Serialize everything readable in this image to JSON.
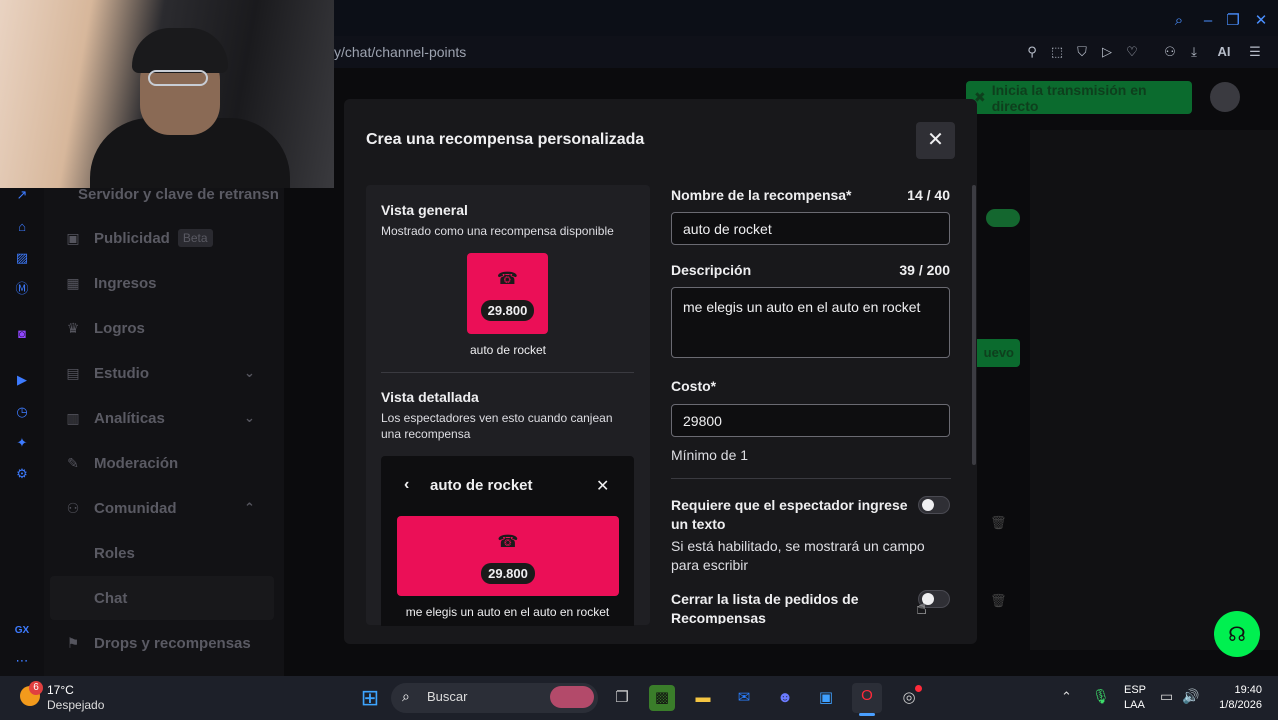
{
  "browser": {
    "url": "y/chat/channel-points",
    "ai_label": "AI"
  },
  "header": {
    "go_live_label": "Inicia la transmisión en directo"
  },
  "sidebar": {
    "items": [
      {
        "label": "Servidor y clave de retransn",
        "icon": "key-icon"
      },
      {
        "label": "Publicidad",
        "badge": "Beta",
        "icon": "ad-icon"
      },
      {
        "label": "Ingresos",
        "icon": "revenue-icon"
      },
      {
        "label": "Logros",
        "icon": "trophy-icon"
      },
      {
        "label": "Estudio",
        "icon": "studio-icon"
      },
      {
        "label": "Analíticas",
        "icon": "analytics-icon"
      },
      {
        "label": "Moderación",
        "icon": "wrench-icon"
      },
      {
        "label": "Comunidad",
        "icon": "community-icon"
      },
      {
        "label": "Roles"
      },
      {
        "label": "Chat"
      },
      {
        "label": "Drops y recompensas",
        "icon": "gift-icon"
      }
    ]
  },
  "background": {
    "nuevo_label": "uevo"
  },
  "modal": {
    "title": "Crea una recompensa personalizada",
    "preview": {
      "general_title": "Vista general",
      "general_desc": "Mostrado como una recompensa disponible",
      "detail_title": "Vista detallada",
      "detail_desc": "Los espectadores ven esto cuando canjean una recompensa",
      "reward_name": "auto de rocket",
      "reward_cost": "29.800",
      "reward_description": "me elegis un auto en el auto en rocket"
    },
    "form": {
      "name_label": "Nombre de la recompensa*",
      "name_count": "14 / 40",
      "name_value": "auto de rocket",
      "desc_label": "Descripción",
      "desc_count": "39 / 200",
      "desc_value": "me elegis un auto en el auto  en rocket",
      "cost_label": "Costo*",
      "cost_value": "29800",
      "cost_min": "Mínimo de 1",
      "require_text_label": "Requiere que el espectador ingrese un texto",
      "require_text_help": "Si está habilitado, se mostrará un campo para escribir",
      "require_text_on": false,
      "close_queue_label": "Cerrar la lista de pedidos de Recompensas",
      "close_queue_on": false
    }
  },
  "taskbar": {
    "weather_badge": "6",
    "weather_temp": "17°C",
    "weather_desc": "Despejado",
    "search_label": "Buscar",
    "lang_top": "ESP",
    "lang_bottom": "LAA",
    "time": "19:40",
    "date": "1/8/2026"
  },
  "colors": {
    "accent_pink": "#eb0f57",
    "green": "#00f050",
    "blue_icons": "#3d7bff"
  }
}
